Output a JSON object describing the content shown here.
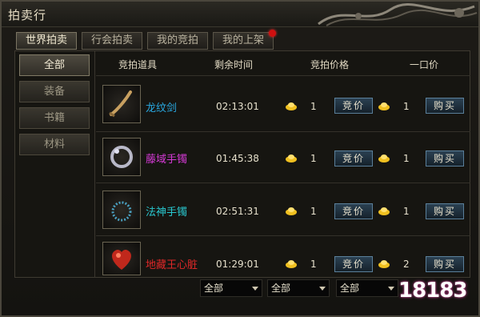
{
  "window": {
    "title": "拍卖行"
  },
  "tabs": [
    {
      "label": "世界拍卖",
      "active": true
    },
    {
      "label": "行会拍卖",
      "active": false
    },
    {
      "label": "我的竞拍",
      "active": false
    },
    {
      "label": "我的上架",
      "active": false,
      "notification_dot": true
    }
  ],
  "categories": [
    {
      "label": "全部",
      "active": true
    },
    {
      "label": "装备",
      "active": false
    },
    {
      "label": "书籍",
      "active": false
    },
    {
      "label": "材料",
      "active": false
    }
  ],
  "columns": {
    "item": "竞拍道具",
    "time_left": "剩余时间",
    "bid_price": "竞拍价格",
    "buyout": "一口价"
  },
  "rows": [
    {
      "name": "龙纹剑",
      "name_color": "#29a8e0",
      "icon": "sword-icon",
      "time_left": "02:13:01",
      "bid_price": "1",
      "bid_label": "竞价",
      "buyout_price": "1",
      "buy_label": "购买"
    },
    {
      "name": "藤域手镯",
      "name_color": "#d63ad6",
      "icon": "bracelet-icon",
      "time_left": "01:45:38",
      "bid_price": "1",
      "bid_label": "竞价",
      "buyout_price": "1",
      "buy_label": "购买"
    },
    {
      "name": "法神手镯",
      "name_color": "#29c8d0",
      "icon": "bracelet-icon",
      "time_left": "02:51:31",
      "bid_price": "1",
      "bid_label": "竞价",
      "buyout_price": "1",
      "buy_label": "购买"
    },
    {
      "name": "地藏王心脏",
      "name_color": "#e02828",
      "icon": "heart-icon",
      "time_left": "01:29:01",
      "bid_price": "1",
      "bid_label": "竞价",
      "buyout_price": "2",
      "buy_label": "购买"
    }
  ],
  "filters": [
    {
      "value": "全部"
    },
    {
      "value": "全部"
    },
    {
      "value": "全部"
    }
  ],
  "watermark": {
    "text": "18183"
  },
  "colors": {
    "gold_ingot": "#f0c020",
    "button_border": "#5a7f9a"
  }
}
